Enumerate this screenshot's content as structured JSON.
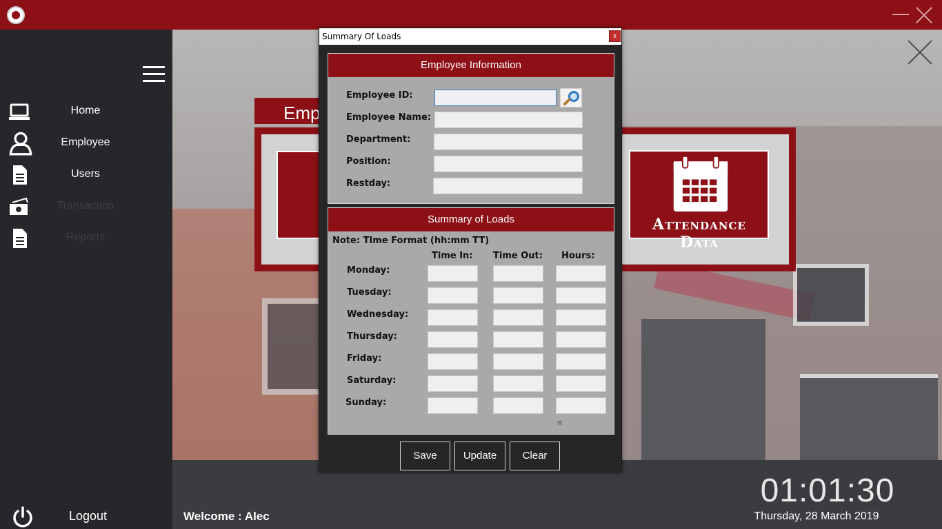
{
  "app": {
    "window_controls": {
      "minimize": "minimize-icon",
      "close": "close-icon"
    }
  },
  "sidebar": {
    "items": [
      {
        "label": "Home",
        "icon": "laptop-icon",
        "enabled": true
      },
      {
        "label": "Employee",
        "icon": "user-icon",
        "enabled": true
      },
      {
        "label": "Users",
        "icon": "document-icon",
        "enabled": true
      },
      {
        "label": "Transaction",
        "icon": "money-icon",
        "enabled": false
      },
      {
        "label": "Reports",
        "icon": "report-icon",
        "enabled": false
      }
    ],
    "logout_label": "Logout"
  },
  "background": {
    "employee_title": "Emp",
    "attendance_label": "Attendance Data"
  },
  "footer": {
    "welcome_label": "Welcome : ",
    "user_name": "Alec",
    "time": "01:01:30",
    "date": "Thursday, 28 March 2019"
  },
  "dialog": {
    "title": "Summary Of Loads",
    "close_label": "x",
    "employee_info": {
      "header": "Employee Information",
      "fields": [
        {
          "label": "Employee ID:",
          "value": ""
        },
        {
          "label": "Employee Name:",
          "value": ""
        },
        {
          "label": "Department:",
          "value": ""
        },
        {
          "label": "Position:",
          "value": ""
        },
        {
          "label": "Restday:",
          "value": ""
        }
      ]
    },
    "summary": {
      "header": "Summary of Loads",
      "note": "Note: TIme Format (hh:mm TT)",
      "columns": [
        "Time In:",
        "Time Out:",
        "Hours:"
      ],
      "days": [
        "Monday:",
        "Tuesday:",
        "Wednesday:",
        "Thursday:",
        "Friday:",
        "Saturday:",
        "Sunday:"
      ],
      "total_label": "="
    },
    "buttons": {
      "save": "Save",
      "update": "Update",
      "clear": "Clear"
    }
  },
  "colors": {
    "accent": "#8c1016",
    "sidebar": "#25272a",
    "dialog": "#262626",
    "panel": "#a9a9a9"
  }
}
